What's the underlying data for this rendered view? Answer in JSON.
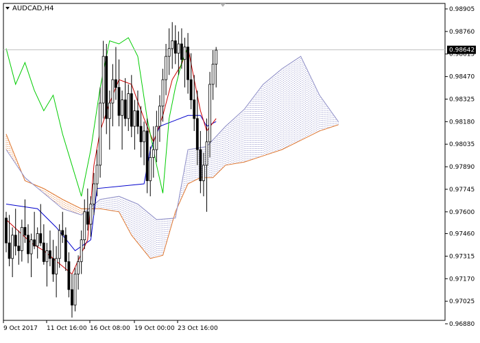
{
  "chart_data": {
    "type": "candlestick",
    "symbol_title": "AUDCAD,H4",
    "current_price_label": "0.98642",
    "current_price": 0.98642,
    "y_ticks": [
      "0.98905",
      "0.98760",
      "0.98615",
      "0.98470",
      "0.98325",
      "0.98180",
      "0.98035",
      "0.97890",
      "0.97745",
      "0.97600",
      "0.97460",
      "0.97315",
      "0.97170",
      "0.97025",
      "0.96880"
    ],
    "x_ticks": [
      "9 Oct 2017",
      "11 Oct 16:00",
      "16 Oct 08:00",
      "19 Oct 00:00",
      "23 Oct 16:00"
    ],
    "ylim": [
      0.9688,
      0.98905
    ],
    "grid": false,
    "colors": {
      "candle": "#000000",
      "tenkan": "#cc0000",
      "kijun": "#0000cc",
      "chikou": "#00cc00",
      "senkou_a": "#e07830",
      "senkou_b": "#9090c8",
      "price_line": "#c0c0c0",
      "axis": "#000000"
    },
    "ohlc": [
      [
        0.9756,
        0.976,
        0.9734,
        0.974
      ],
      [
        0.974,
        0.9758,
        0.9725,
        0.973
      ],
      [
        0.973,
        0.975,
        0.9718,
        0.9745
      ],
      [
        0.9745,
        0.9762,
        0.9732,
        0.9738
      ],
      [
        0.9738,
        0.9748,
        0.9726,
        0.9735
      ],
      [
        0.9735,
        0.9755,
        0.9728,
        0.975
      ],
      [
        0.975,
        0.9768,
        0.974,
        0.9745
      ],
      [
        0.9745,
        0.9752,
        0.9727,
        0.9733
      ],
      [
        0.9733,
        0.9746,
        0.9718,
        0.9742
      ],
      [
        0.9742,
        0.976,
        0.9736,
        0.9738
      ],
      [
        0.9738,
        0.975,
        0.973,
        0.9746
      ],
      [
        0.9746,
        0.9765,
        0.9738,
        0.974
      ],
      [
        0.974,
        0.9752,
        0.9726,
        0.9728
      ],
      [
        0.9728,
        0.974,
        0.9712,
        0.9735
      ],
      [
        0.9735,
        0.9748,
        0.9725,
        0.973
      ],
      [
        0.973,
        0.9742,
        0.9715,
        0.972
      ],
      [
        0.972,
        0.9738,
        0.9705,
        0.973
      ],
      [
        0.973,
        0.9752,
        0.9724,
        0.9748
      ],
      [
        0.9748,
        0.976,
        0.974,
        0.9745
      ],
      [
        0.9745,
        0.975,
        0.9722,
        0.9728
      ],
      [
        0.9728,
        0.9734,
        0.9705,
        0.971
      ],
      [
        0.971,
        0.972,
        0.9692,
        0.97
      ],
      [
        0.97,
        0.9724,
        0.9696,
        0.972
      ],
      [
        0.972,
        0.9732,
        0.971,
        0.9728
      ],
      [
        0.9728,
        0.9748,
        0.972,
        0.9742
      ],
      [
        0.9742,
        0.9768,
        0.9736,
        0.976
      ],
      [
        0.976,
        0.9775,
        0.9748,
        0.9752
      ],
      [
        0.9752,
        0.977,
        0.9744,
        0.9765
      ],
      [
        0.9765,
        0.9785,
        0.9758,
        0.9778
      ],
      [
        0.9778,
        0.98,
        0.977,
        0.979
      ],
      [
        0.979,
        0.984,
        0.9782,
        0.983
      ],
      [
        0.983,
        0.987,
        0.982,
        0.986
      ],
      [
        0.986,
        0.9868,
        0.981,
        0.982
      ],
      [
        0.982,
        0.9838,
        0.98,
        0.983
      ],
      [
        0.983,
        0.9855,
        0.9815,
        0.9845
      ],
      [
        0.9845,
        0.9866,
        0.9832,
        0.984
      ],
      [
        0.984,
        0.9858,
        0.9815,
        0.9822
      ],
      [
        0.9822,
        0.9838,
        0.98,
        0.9832
      ],
      [
        0.9832,
        0.9846,
        0.9815,
        0.982
      ],
      [
        0.982,
        0.9842,
        0.9812,
        0.9836
      ],
      [
        0.9836,
        0.9848,
        0.9808,
        0.9815
      ],
      [
        0.9815,
        0.9832,
        0.98,
        0.9825
      ],
      [
        0.9825,
        0.9838,
        0.981,
        0.9815
      ],
      [
        0.9815,
        0.9828,
        0.9795,
        0.9805
      ],
      [
        0.9805,
        0.9818,
        0.979,
        0.9812
      ],
      [
        0.9812,
        0.982,
        0.9772,
        0.978
      ],
      [
        0.978,
        0.9802,
        0.977,
        0.9795
      ],
      [
        0.9795,
        0.9815,
        0.9782,
        0.98
      ],
      [
        0.98,
        0.9825,
        0.9792,
        0.9815
      ],
      [
        0.9815,
        0.9835,
        0.9805,
        0.9828
      ],
      [
        0.9828,
        0.9852,
        0.9818,
        0.9845
      ],
      [
        0.9845,
        0.9868,
        0.9835,
        0.986
      ],
      [
        0.986,
        0.9878,
        0.9848,
        0.9865
      ],
      [
        0.9865,
        0.9882,
        0.9852,
        0.987
      ],
      [
        0.987,
        0.988,
        0.9855,
        0.9862
      ],
      [
        0.9862,
        0.9876,
        0.9848,
        0.9868
      ],
      [
        0.9868,
        0.9878,
        0.9852,
        0.9858
      ],
      [
        0.9858,
        0.9872,
        0.984,
        0.9866
      ],
      [
        0.9866,
        0.9875,
        0.9836,
        0.9845
      ],
      [
        0.9845,
        0.9862,
        0.9826,
        0.9832
      ],
      [
        0.9832,
        0.9848,
        0.9812,
        0.982
      ],
      [
        0.982,
        0.9838,
        0.979,
        0.98
      ],
      [
        0.98,
        0.9812,
        0.9772,
        0.978
      ],
      [
        0.978,
        0.9798,
        0.977,
        0.979
      ],
      [
        0.979,
        0.982,
        0.976,
        0.9805
      ],
      [
        0.9805,
        0.985,
        0.9795,
        0.9842
      ],
      [
        0.9842,
        0.9864,
        0.9832,
        0.9855
      ],
      [
        0.9855,
        0.9866,
        0.984,
        0.9864
      ]
    ],
    "tenkan": [
      [
        0,
        0.9755
      ],
      [
        8,
        0.974
      ],
      [
        12,
        0.9735
      ],
      [
        18,
        0.9725
      ],
      [
        21,
        0.972
      ],
      [
        26,
        0.9742
      ],
      [
        28,
        0.979
      ],
      [
        30,
        0.9812
      ],
      [
        33,
        0.983
      ],
      [
        36,
        0.9845
      ],
      [
        40,
        0.9842
      ],
      [
        44,
        0.982
      ],
      [
        47,
        0.9805
      ],
      [
        50,
        0.9822
      ],
      [
        53,
        0.9845
      ],
      [
        56,
        0.9855
      ],
      [
        58,
        0.9866
      ],
      [
        60,
        0.9845
      ],
      [
        62,
        0.9825
      ],
      [
        64,
        0.9812
      ],
      [
        67,
        0.982
      ]
    ],
    "kijun": [
      [
        0,
        0.9765
      ],
      [
        10,
        0.9762
      ],
      [
        16,
        0.975
      ],
      [
        22,
        0.9735
      ],
      [
        27,
        0.9742
      ],
      [
        29,
        0.9775
      ],
      [
        44,
        0.9778
      ],
      [
        46,
        0.98
      ],
      [
        49,
        0.9815
      ],
      [
        58,
        0.9822
      ],
      [
        62,
        0.9822
      ],
      [
        64,
        0.9815
      ],
      [
        67,
        0.9818
      ]
    ],
    "chikou": [
      [
        0,
        0.9865
      ],
      [
        3,
        0.9842
      ],
      [
        6,
        0.9856
      ],
      [
        9,
        0.9838
      ],
      [
        12,
        0.9825
      ],
      [
        15,
        0.9835
      ],
      [
        18,
        0.981
      ],
      [
        21,
        0.979
      ],
      [
        24,
        0.977
      ],
      [
        27,
        0.98
      ],
      [
        30,
        0.984
      ],
      [
        33,
        0.987
      ],
      [
        36,
        0.9868
      ],
      [
        39,
        0.9872
      ],
      [
        42,
        0.986
      ],
      [
        45,
        0.982
      ],
      [
        48,
        0.979
      ],
      [
        50,
        0.9772
      ],
      [
        52,
        0.982
      ],
      [
        54,
        0.984
      ],
      [
        56,
        0.9856
      ],
      [
        58,
        0.9866
      ]
    ],
    "senkou_a": [
      [
        0,
        0.981
      ],
      [
        6,
        0.978
      ],
      [
        12,
        0.9775
      ],
      [
        18,
        0.9768
      ],
      [
        24,
        0.9762
      ],
      [
        30,
        0.9762
      ],
      [
        36,
        0.976
      ],
      [
        40,
        0.9745
      ],
      [
        46,
        0.973
      ],
      [
        50,
        0.9732
      ],
      [
        54,
        0.976
      ],
      [
        58,
        0.9778
      ],
      [
        62,
        0.9782
      ],
      [
        66,
        0.9782
      ],
      [
        70,
        0.979
      ],
      [
        76,
        0.9792
      ],
      [
        82,
        0.9796
      ],
      [
        88,
        0.98
      ],
      [
        94,
        0.9806
      ],
      [
        100,
        0.9812
      ],
      [
        106,
        0.9816
      ]
    ],
    "senkou_b": [
      [
        0,
        0.98
      ],
      [
        6,
        0.9782
      ],
      [
        12,
        0.9772
      ],
      [
        18,
        0.9762
      ],
      [
        24,
        0.9758
      ],
      [
        30,
        0.9768
      ],
      [
        36,
        0.977
      ],
      [
        42,
        0.9765
      ],
      [
        48,
        0.9755
      ],
      [
        54,
        0.9756
      ],
      [
        58,
        0.98
      ],
      [
        64,
        0.9802
      ],
      [
        70,
        0.9815
      ],
      [
        76,
        0.9826
      ],
      [
        82,
        0.9842
      ],
      [
        88,
        0.9852
      ],
      [
        94,
        0.986
      ],
      [
        100,
        0.9835
      ],
      [
        106,
        0.9818
      ]
    ]
  }
}
